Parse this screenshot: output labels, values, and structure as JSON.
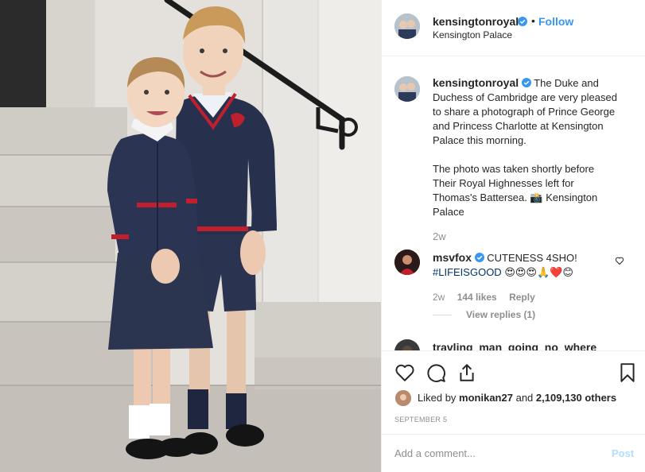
{
  "post": {
    "username": "kensingtonroyal",
    "follow_label": "Follow",
    "separator": "•",
    "location": "Kensington Palace"
  },
  "caption": {
    "username": "kensingtonroyal",
    "paragraph1": "The Duke and Duchess of Cambridge are very pleased to share a photograph of Prince George and Princess Charlotte at Kensington Palace this morning.",
    "paragraph2": "The photo was taken shortly before Their Royal Highnesses left for Thomas's Battersea. 📸 Kensington Palace",
    "time": "2w"
  },
  "comments": [
    {
      "username": "msvfox",
      "text": "CUTENESS 4SHO!",
      "hashtag": "#LIFEISGOOD",
      "emojis": "😍😍😍🙏❤️😊",
      "time": "2w",
      "likes": "144 likes",
      "reply_label": "Reply",
      "view_replies": "View replies (1)"
    },
    {
      "username": "travling_man_going_no_where"
    }
  ],
  "likes": {
    "prefix": "Liked by",
    "user": "monikan27",
    "joiner": "and",
    "others": "2,109,130 others"
  },
  "date": "SEPTEMBER 5",
  "add_comment": {
    "placeholder": "Add a comment...",
    "post_label": "Post"
  },
  "icons": {
    "like": "heart-icon",
    "comment": "comment-icon",
    "share": "share-icon",
    "save": "bookmark-icon",
    "verified": "verified-badge-icon"
  },
  "colors": {
    "link_blue": "#3897f0",
    "muted": "#8e8e8e",
    "hashtag": "#003569",
    "post_disabled": "#b2dffc"
  }
}
